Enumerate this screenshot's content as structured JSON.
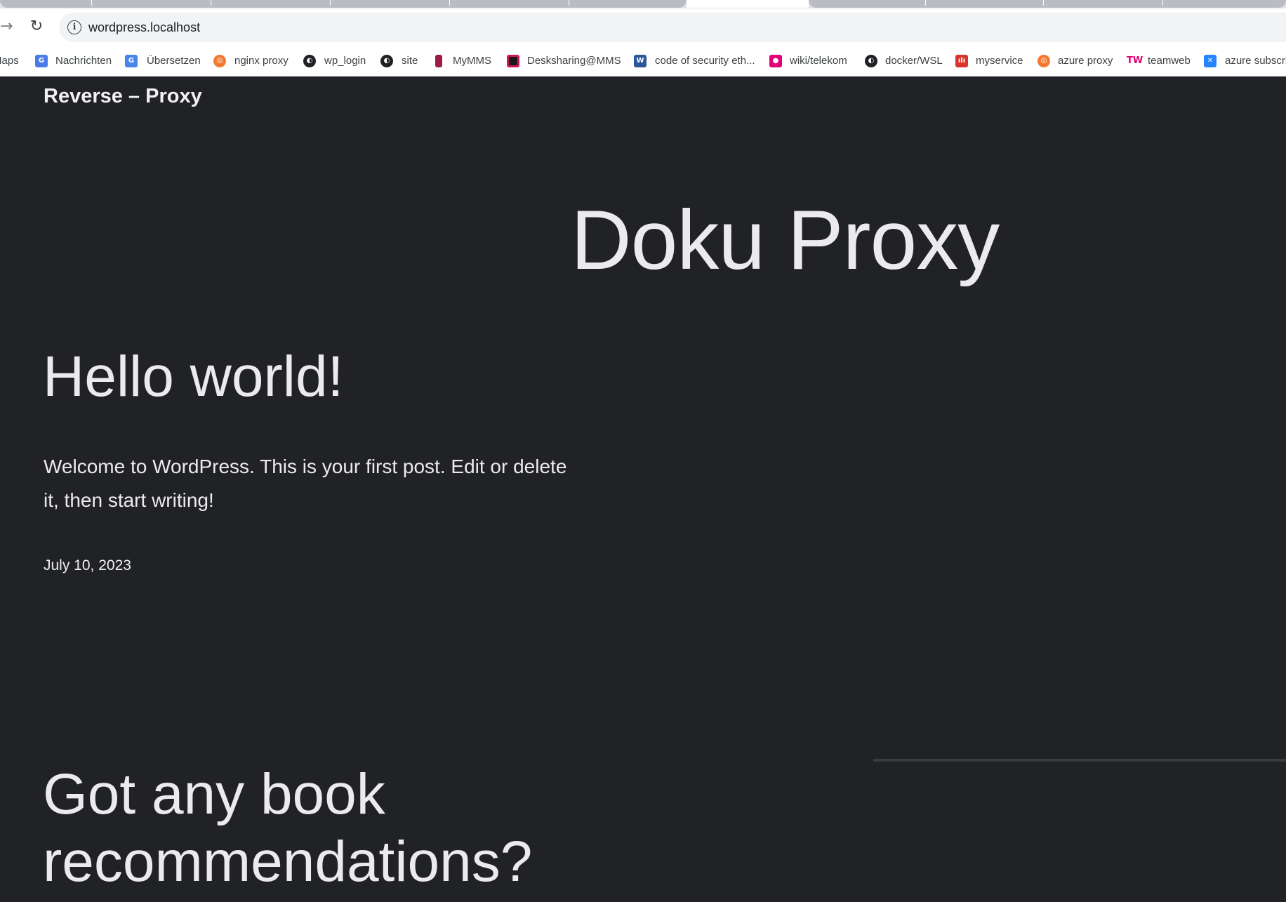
{
  "browser": {
    "url": "wordpress.localhost",
    "bookmarks": [
      {
        "label": "Maps",
        "icon": "maps-icon"
      },
      {
        "label": "Nachrichten",
        "icon": "news-icon"
      },
      {
        "label": "Übersetzen",
        "icon": "translate-icon"
      },
      {
        "label": "nginx proxy",
        "icon": "grafana-icon"
      },
      {
        "label": "wp_login",
        "icon": "globe-icon"
      },
      {
        "label": "site",
        "icon": "globe-icon"
      },
      {
        "label": "MyMMS",
        "icon": "mms-icon"
      },
      {
        "label": "Desksharing@MMS",
        "icon": "desksharing-icon"
      },
      {
        "label": "code of security eth...",
        "icon": "word-icon"
      },
      {
        "label": "wiki/telekom",
        "icon": "telekom-wiki-icon"
      },
      {
        "label": "docker/WSL",
        "icon": "globe-icon"
      },
      {
        "label": "myservice",
        "icon": "myservice-icon"
      },
      {
        "label": "azure proxy",
        "icon": "grafana-icon"
      },
      {
        "label": "teamweb",
        "icon": "tw-icon"
      },
      {
        "label": "azure subscri",
        "icon": "confluence-icon"
      }
    ]
  },
  "site": {
    "title": "Reverse – Proxy",
    "hero_title": "Doku Proxy"
  },
  "posts": [
    {
      "title": "Hello world!",
      "excerpt": "Welcome to WordPress. This is your first post. Edit or delete it, then start writing!",
      "date": "July 10, 2023"
    },
    {
      "title": "Got any book recommendations?"
    }
  ],
  "colors": {
    "background": "#212226",
    "text": "#eceaef"
  }
}
